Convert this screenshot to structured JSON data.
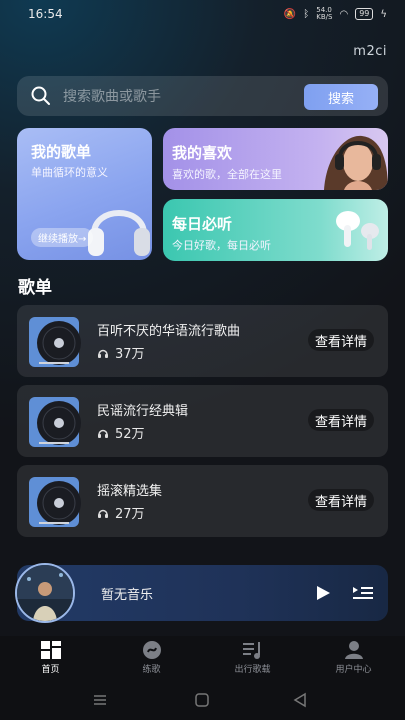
{
  "status": {
    "time": "16:54",
    "network_speed": "54.0\nKB/S",
    "battery": "99"
  },
  "brand": "m2ci",
  "search": {
    "placeholder": "搜索歌曲或歌手",
    "button_label": "搜索"
  },
  "cards": {
    "fav_songs": {
      "title": "我的歌单",
      "subtitle": "单曲循环的意义",
      "action": "继续播放→"
    },
    "my_likes": {
      "title": "我的喜欢",
      "subtitle": "喜欢的歌，全部在这里"
    },
    "daily": {
      "title": "每日必听",
      "subtitle": "今日好歌，每日必听"
    }
  },
  "section_title": "歌单",
  "playlists": [
    {
      "name": "百听不厌的华语流行歌曲",
      "count": "37万",
      "action": "查看详情"
    },
    {
      "name": "民谣流行经典辑",
      "count": "52万",
      "action": "查看详情"
    },
    {
      "name": "摇滚精选集",
      "count": "27万",
      "action": "查看详情"
    }
  ],
  "player": {
    "title": "暂无音乐"
  },
  "tabs": [
    {
      "label": "首页",
      "icon": "home-grid-icon",
      "active": true
    },
    {
      "label": "练歌",
      "icon": "practice-icon",
      "active": false
    },
    {
      "label": "出行歌载",
      "icon": "music-list-icon",
      "active": false
    },
    {
      "label": "用户中心",
      "icon": "user-icon",
      "active": false
    }
  ],
  "colors": {
    "accent": "#8aa4ef",
    "likes_card": "#a391e8",
    "daily_card": "#3bc7b0"
  }
}
